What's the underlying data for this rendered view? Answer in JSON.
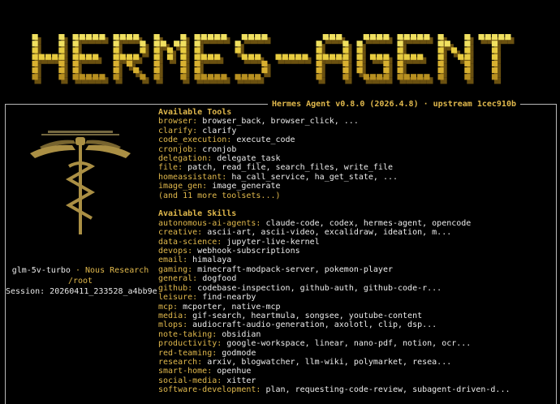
{
  "banner": {
    "text": "HERMES-AGENT",
    "colors": [
      "#f0e060",
      "#e8cc40",
      "#d8b030",
      "#b89020"
    ]
  },
  "panel": {
    "title": "Hermes Agent v0.8.0 (2026.4.8) · upstream 1cec910b"
  },
  "session": {
    "model": "glm-5v-turbo",
    "separator": " · ",
    "provider": "Nous Research",
    "cwd": "/root",
    "session_id": "Session: 20260411_233528_a4bb9e"
  },
  "tools": {
    "title": "Available Tools",
    "items": [
      {
        "key": "browser:",
        "value": " browser_back, browser_click, ..."
      },
      {
        "key": "clarify:",
        "value": " clarify"
      },
      {
        "key": "code_execution:",
        "value": " execute_code"
      },
      {
        "key": "cronjob:",
        "value": " cronjob"
      },
      {
        "key": "delegation:",
        "value": " delegate_task"
      },
      {
        "key": "file:",
        "value": " patch, read_file, search_files, write_file"
      },
      {
        "key": "homeassistant:",
        "value": " ha_call_service, ha_get_state, ..."
      },
      {
        "key": "image_gen:",
        "value": " image_generate"
      }
    ],
    "more": "(and 11 more toolsets...)"
  },
  "skills": {
    "title": "Available Skills",
    "items": [
      {
        "key": "autonomous-ai-agents:",
        "value": " claude-code, codex, hermes-agent, opencode"
      },
      {
        "key": "creative:",
        "value": " ascii-art, ascii-video, excalidraw, ideation, m..."
      },
      {
        "key": "data-science:",
        "value": " jupyter-live-kernel"
      },
      {
        "key": "devops:",
        "value": " webhook-subscriptions"
      },
      {
        "key": "email:",
        "value": " himalaya"
      },
      {
        "key": "gaming:",
        "value": " minecraft-modpack-server, pokemon-player"
      },
      {
        "key": "general:",
        "value": " dogfood"
      },
      {
        "key": "github:",
        "value": " codebase-inspection, github-auth, github-code-r..."
      },
      {
        "key": "leisure:",
        "value": " find-nearby"
      },
      {
        "key": "mcp:",
        "value": " mcporter, native-mcp"
      },
      {
        "key": "media:",
        "value": " gif-search, heartmula, songsee, youtube-content"
      },
      {
        "key": "mlops:",
        "value": " audiocraft-audio-generation, axolotl, clip, dsp..."
      },
      {
        "key": "note-taking:",
        "value": " obsidian"
      },
      {
        "key": "productivity:",
        "value": " google-workspace, linear, nano-pdf, notion, ocr..."
      },
      {
        "key": "red-teaming:",
        "value": " godmode"
      },
      {
        "key": "research:",
        "value": " arxiv, blogwatcher, llm-wiki, polymarket, resea..."
      },
      {
        "key": "smart-home:",
        "value": " openhue"
      },
      {
        "key": "social-media:",
        "value": " xitter"
      },
      {
        "key": "software-development:",
        "value": " plan, requesting-code-review, subagent-driven-d..."
      }
    ]
  },
  "colors": {
    "background": "#000000",
    "accent": "#e0b84c",
    "text": "#ececec",
    "border": "#b8b8b8"
  }
}
